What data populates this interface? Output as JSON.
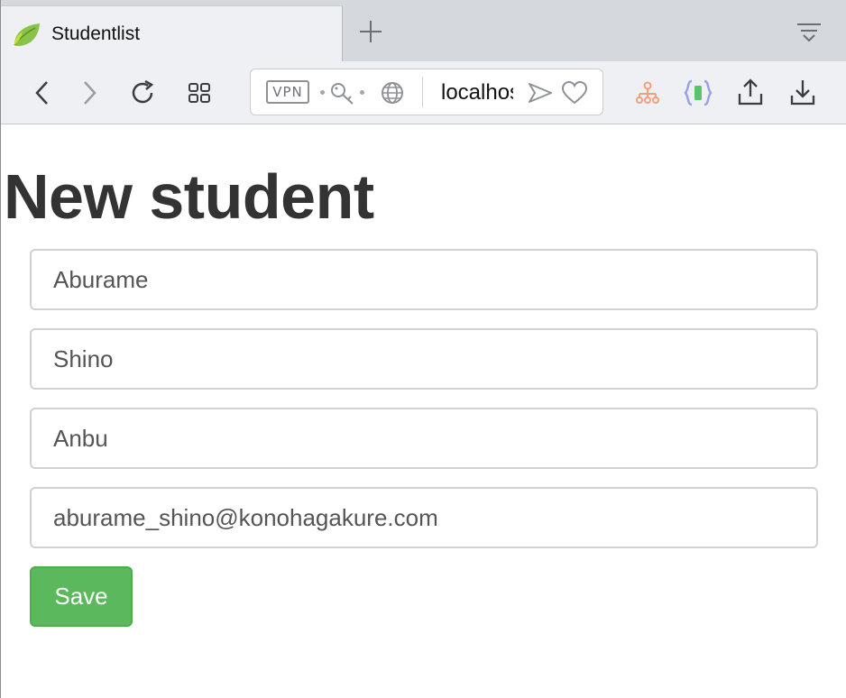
{
  "browser": {
    "tab_title": "Studentlist",
    "address_bar": {
      "vpn_label": "VPN",
      "url": "localhost"
    },
    "accent_extension_color": "#f0a07a"
  },
  "form": {
    "title": "New student",
    "fields": [
      {
        "name": "lastname",
        "value": "Aburame"
      },
      {
        "name": "firstname",
        "value": "Shino"
      },
      {
        "name": "department",
        "value": "Anbu"
      },
      {
        "name": "email",
        "value": "aburame_shino@konohagakure.com"
      }
    ],
    "save_label": "Save",
    "save_color": "#5cb85c"
  }
}
